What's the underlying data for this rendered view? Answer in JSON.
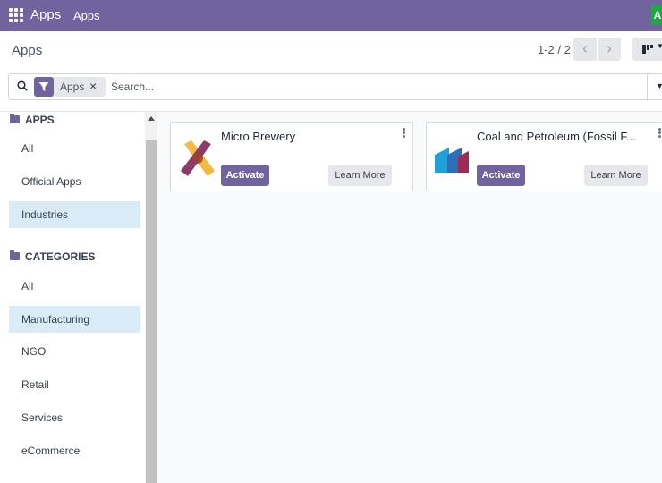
{
  "navbar": {
    "brand": "Apps",
    "menu_item": "Apps",
    "avatar_initial": "A",
    "apps_menu_icon": "grid-icon",
    "bg_color": "#71639e"
  },
  "control_panel": {
    "breadcrumb": "Apps",
    "pager": {
      "value": "1-2 / 2",
      "prev_icon": "chevron-left-icon",
      "next_icon": "chevron-right-icon"
    },
    "view_switcher_icon": "kanban-view-icon"
  },
  "search": {
    "icon": "search-icon",
    "facet": {
      "icon": "filter-icon",
      "label": "Apps",
      "remove": "×"
    },
    "placeholder": "Search...",
    "toggle_icon": "caret-down-icon"
  },
  "sidebar": {
    "sections": [
      {
        "title": "APPS",
        "icon": "folder-icon",
        "items": [
          {
            "label": "All",
            "active": false
          },
          {
            "label": "Official Apps",
            "active": false
          },
          {
            "label": "Industries",
            "active": true
          }
        ]
      },
      {
        "title": "CATEGORIES",
        "icon": "folder-icon",
        "items": [
          {
            "label": "All",
            "active": false
          },
          {
            "label": "Manufacturing",
            "active": true
          },
          {
            "label": "NGO",
            "active": false
          },
          {
            "label": "Retail",
            "active": false
          },
          {
            "label": "Services",
            "active": false
          },
          {
            "label": "eCommerce",
            "active": false
          }
        ]
      }
    ],
    "active_color": "#d8ebf7"
  },
  "cards": [
    {
      "title": "Micro Brewery",
      "logo_icon": "bottle-logo-icon",
      "activate_label": "Activate",
      "learn_more_label": "Learn More"
    },
    {
      "title": "Coal and Petroleum (Fossil F...",
      "logo_icon": "industry-logo-icon",
      "activate_label": "Activate",
      "learn_more_label": "Learn More"
    }
  ],
  "colors": {
    "primary": "#71639e",
    "avatar": "#22a447"
  }
}
